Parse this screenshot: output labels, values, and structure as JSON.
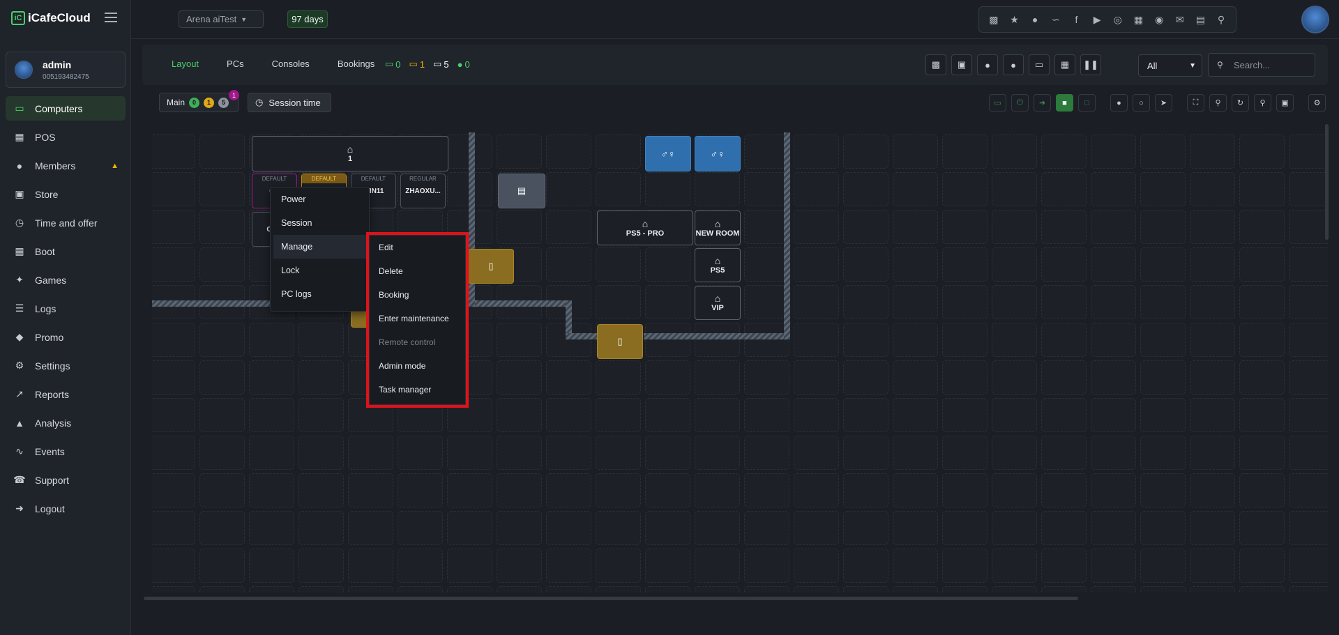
{
  "app": {
    "logo_text": "iCafeCloud",
    "logo_mark": "iC"
  },
  "topbar": {
    "branch": "Arena aiTest",
    "days_badge": "97 days",
    "icons": [
      "sitemap-icon",
      "trophy-icon",
      "users-icon",
      "rss-icon",
      "facebook-icon",
      "youtube-icon",
      "globe-icon",
      "news-icon",
      "eye-slash-icon",
      "mail-icon",
      "chat-icon",
      "search-icon"
    ]
  },
  "user": {
    "name": "admin",
    "id": "005193482475"
  },
  "sidebar": {
    "items": [
      {
        "label": "Computers",
        "icon": "monitor-icon",
        "active": true
      },
      {
        "label": "POS",
        "icon": "register-icon"
      },
      {
        "label": "Members",
        "icon": "members-icon",
        "badge": "crown-icon"
      },
      {
        "label": "Store",
        "icon": "bag-icon"
      },
      {
        "label": "Time and offer",
        "icon": "clock-icon"
      },
      {
        "label": "Boot",
        "icon": "windows-icon"
      },
      {
        "label": "Games",
        "icon": "gamepad-icon"
      },
      {
        "label": "Logs",
        "icon": "list-icon"
      },
      {
        "label": "Promo",
        "icon": "tag-icon"
      },
      {
        "label": "Settings",
        "icon": "gear-icon"
      },
      {
        "label": "Reports",
        "icon": "chart-line-icon"
      },
      {
        "label": "Analysis",
        "icon": "chart-area-icon"
      },
      {
        "label": "Events",
        "icon": "pulse-icon"
      },
      {
        "label": "Support",
        "icon": "phone-icon"
      },
      {
        "label": "Logout",
        "icon": "logout-icon"
      }
    ]
  },
  "subbar": {
    "tabs": [
      {
        "label": "Layout",
        "active": true
      },
      {
        "label": "PCs"
      },
      {
        "label": "Consoles"
      },
      {
        "label": "Bookings"
      }
    ],
    "counters": [
      {
        "icon": "monitor-online-icon",
        "value": "0",
        "color": "#4ccf6b"
      },
      {
        "icon": "monitor-busy-icon",
        "value": "1",
        "color": "#f2b400"
      },
      {
        "icon": "monitor-total-icon",
        "value": "5",
        "color": "#ffffff"
      },
      {
        "icon": "user-online-icon",
        "value": "0",
        "color": "#4ccf6b"
      }
    ],
    "filter_value": "All",
    "search_placeholder": "Search..."
  },
  "area": {
    "name": "Main",
    "counts": [
      {
        "value": "0",
        "color": "#3fae5a"
      },
      {
        "value": "1",
        "color": "#e0a81c"
      },
      {
        "value": "5",
        "color": "#8d939c"
      }
    ],
    "notification": "1",
    "session_time_label": "Session time"
  },
  "layout": {
    "rooms": [
      {
        "label": "1"
      },
      {
        "label": "PS5 - PRO"
      },
      {
        "label": "NEW ROOM"
      },
      {
        "label": "PS5"
      },
      {
        "label": "VIP"
      }
    ],
    "pcs": [
      {
        "group": "DEFAULT",
        "name": "GE",
        "status_color": "#a1178a"
      },
      {
        "group": "DEFAULT",
        "name": "",
        "status_color": "#c98a12"
      },
      {
        "group": "DEFAULT",
        "name": "WIN11"
      },
      {
        "group": "REGULAR",
        "name": "ZHAOXU..."
      },
      {
        "group": "DE",
        "name": "CON"
      }
    ]
  },
  "context_menu": {
    "items": [
      "Power",
      "Session",
      "Manage",
      "Lock",
      "PC logs"
    ],
    "active": "Manage"
  },
  "submenu": {
    "items": [
      "Edit",
      "Delete",
      "Booking",
      "Enter maintenance",
      "Remote control",
      "Admin mode",
      "Task manager"
    ],
    "disabled": [
      "Remote control"
    ]
  },
  "colors": {
    "accent": "#4ccf6b",
    "highlight": "#e01218",
    "warning": "#f2b400"
  }
}
